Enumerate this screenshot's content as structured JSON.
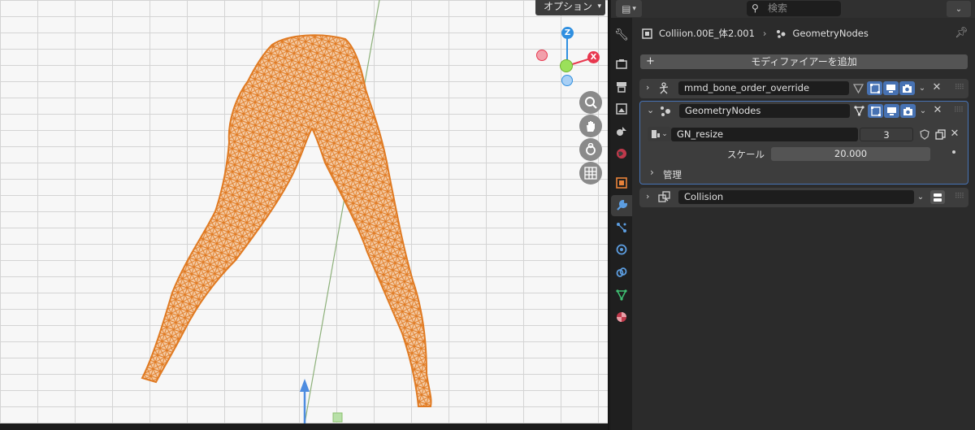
{
  "viewport": {
    "options_label": "オプション",
    "gizmo": {
      "z_label": "Z",
      "x_label": "X"
    },
    "nav_icons": [
      "zoom-icon",
      "hand-pan-icon",
      "camera-icon",
      "grid-ortho-icon"
    ]
  },
  "header": {
    "search_placeholder": "検索"
  },
  "breadcrumb": {
    "object": "Colliion.00E_体2.001",
    "modifier": "GeometryNodes"
  },
  "add_modifier_label": "モディファイアーを追加",
  "modifiers": [
    {
      "name": "mmd_bone_order_override",
      "expanded": false
    },
    {
      "name": "GeometryNodes",
      "expanded": true,
      "node_group": {
        "name": "GN_resize",
        "users": "3"
      },
      "inputs": [
        {
          "label": "スケール",
          "value": "20.000"
        }
      ],
      "manage_label": "管理"
    },
    {
      "name": "Collision",
      "expanded": false
    }
  ],
  "colors": {
    "accent": "#4772b3",
    "wire": "#e6822a",
    "axis_x": "#e8384f",
    "axis_y": "#8cd64a",
    "axis_z": "#2f8fe0"
  }
}
